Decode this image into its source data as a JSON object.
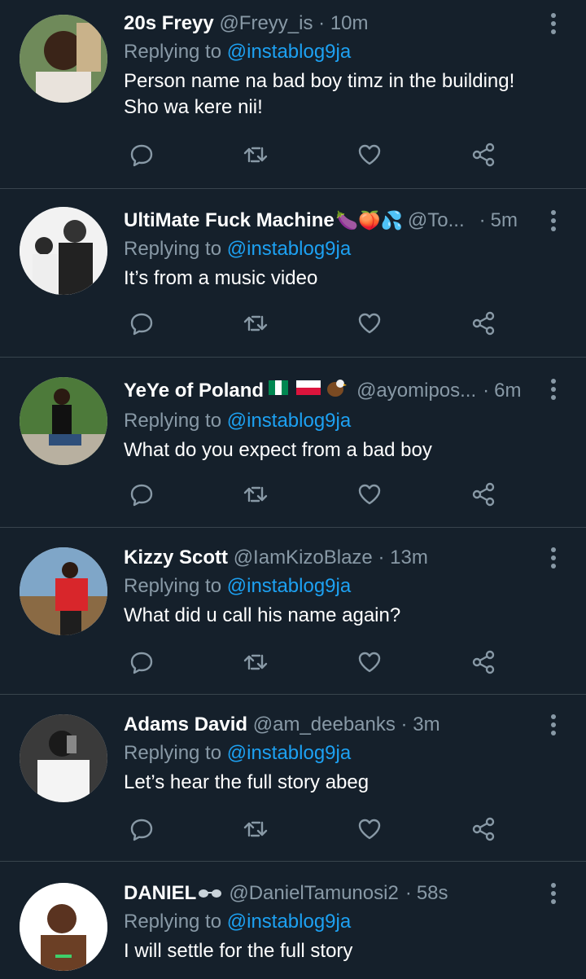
{
  "replying_prefix": "Replying to",
  "colors": {
    "background": "#15202b",
    "muted": "#8899a6",
    "accent": "#1da1f2",
    "divider": "#38444d"
  },
  "tweets": [
    {
      "name": "20s Freyy",
      "handle": "@Freyy_is",
      "time": "10m",
      "reply_to": "@instablog9ja",
      "text": "Person name na bad boy timz in the building! Sho wa kere nii!",
      "emoji": ""
    },
    {
      "name": "UltiMate Fuck Machine",
      "handle": "@To...",
      "time": "5m",
      "reply_to": "@instablog9ja",
      "text": "It’s from a music video",
      "emoji": "🍆🍑💦"
    },
    {
      "name": "YeYe of Poland",
      "handle": "@ayomipos...",
      "time": "6m",
      "reply_to": "@instablog9ja",
      "text": "What do you expect from a bad boy",
      "emoji": "flags"
    },
    {
      "name": "Kizzy Scott",
      "handle": "@IamKizoBlaze",
      "time": "13m",
      "reply_to": "@instablog9ja",
      "text": "What did u call his name again?",
      "emoji": ""
    },
    {
      "name": "Adams David",
      "handle": "@am_deebanks",
      "time": "3m",
      "reply_to": "@instablog9ja",
      "text": "Let’s hear the full story abeg",
      "emoji": ""
    },
    {
      "name": "DANIEL",
      "handle": "@DanielTamunosi2",
      "time": "58s",
      "reply_to": "@instablog9ja",
      "text": "I will settle for the full story",
      "emoji": "sunglasses"
    }
  ],
  "action_icons": [
    "reply-icon",
    "retweet-icon",
    "like-icon",
    "share-icon"
  ]
}
